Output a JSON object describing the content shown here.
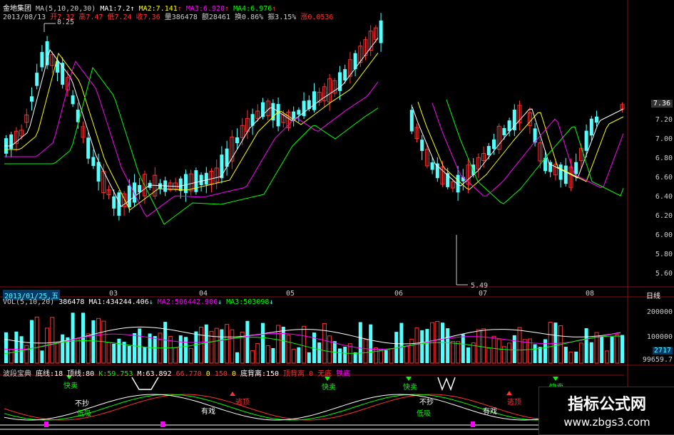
{
  "header": {
    "stock_name": "金地集团",
    "ma_title": "MA(5,10,20,30)",
    "ma1": "MA1:7.2",
    "ma2": "MA2:7.141",
    "ma3": "MA3:6.920",
    "ma4": "MA4:6.976",
    "date": "2013/08/13",
    "open": "开7.32",
    "high": "高7.47",
    "low": "低7.24",
    "close": "收7.36",
    "volume": "量386478",
    "amount": "额28461",
    "turnover": "换0.86%",
    "amplitude": "振3.15%",
    "change": "涨0.0536"
  },
  "price_axis": {
    "labels": [
      "7.20",
      "7.00",
      "6.80",
      "6.60",
      "6.40",
      "6.20",
      "6.00",
      "5.80",
      "5.60"
    ],
    "current_price_tag": "7.36",
    "high_marker": "8.25",
    "low_marker": "5.49"
  },
  "x_axis": {
    "first_date": "2013/01/25,五",
    "months": [
      "03",
      "04",
      "05",
      "06",
      "07",
      "08"
    ],
    "period": "日线"
  },
  "volume_panel": {
    "title": "VOL(5,10,20)",
    "vol": "386478",
    "ma1": "MA1:434244.406",
    "ma2": "MA2:506442.906",
    "ma3": "MA3:503098",
    "axis": [
      "200000",
      "100000"
    ],
    "tag1": "2717",
    "tag2": "99659.7"
  },
  "indicator_panel": {
    "name": "波段宝典",
    "bottom_line": "底线:18",
    "top_line": "顶线:80",
    "k": "K:59.753",
    "m": "M:63.892",
    "v1": "66.770",
    "v2": "0",
    "v3": "150",
    "v4": "0",
    "bottom_divergence": "底背离:150",
    "top_divergence": "顶背离 0",
    "risk": "无底",
    "iron_bottom": "铁底"
  },
  "signals": {
    "quick_sell": "快卖",
    "no_buy": "不抄",
    "low_buy": "低吸",
    "escape": "逃顶",
    "has_play": "有戏"
  },
  "watermark": {
    "title": "指标公式网",
    "url": "www.zbgs3.com"
  },
  "colors": {
    "up": "#ff3232",
    "down": "#54ffff",
    "ma1": "#ffffff",
    "ma2": "#ffff00",
    "ma3": "#ff00ff",
    "ma4": "#00ff00",
    "grid": "#8a1010"
  }
}
